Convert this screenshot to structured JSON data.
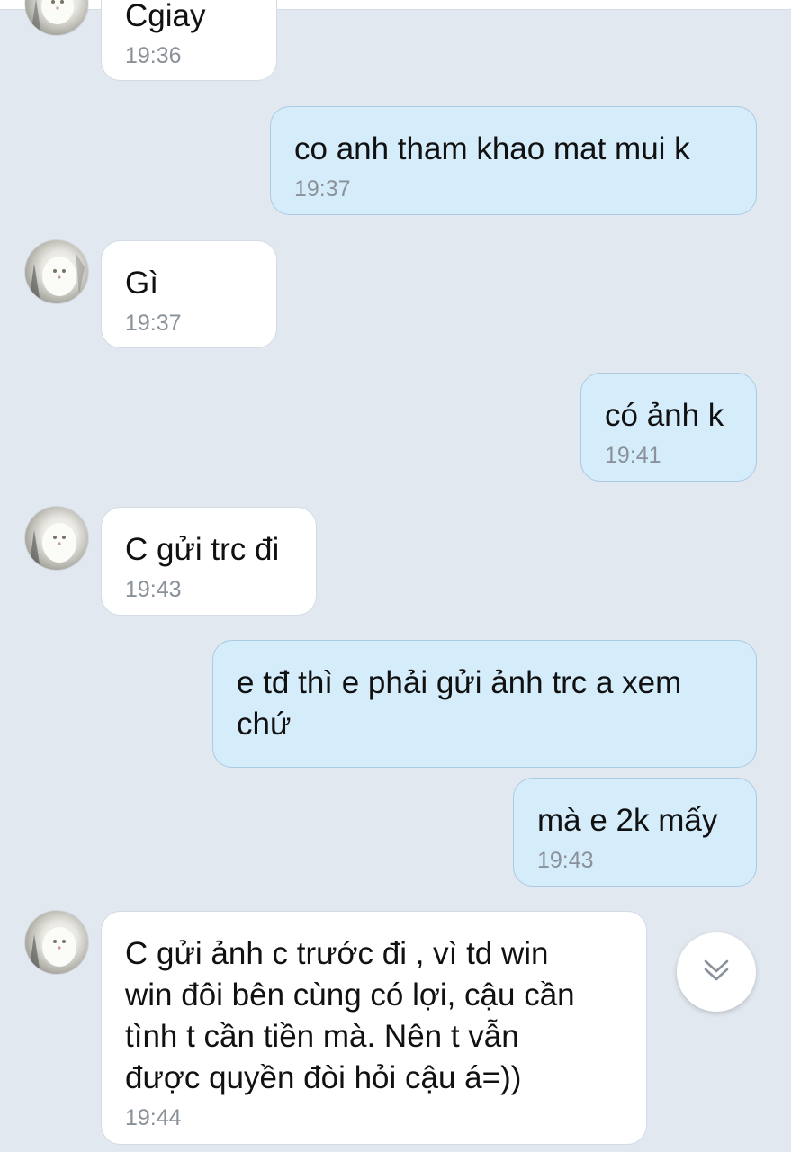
{
  "colors": {
    "background": "#e2e8f0",
    "incoming_bubble": "#ffffff",
    "outgoing_bubble": "#d5ecfb",
    "timestamp": "#8a9199"
  },
  "messages": [
    {
      "direction": "in",
      "text": "Cgiay",
      "time": "19:36",
      "avatar": "cat-avatar"
    },
    {
      "direction": "out",
      "text": "co anh tham khao mat mui k",
      "time": "19:37"
    },
    {
      "direction": "in",
      "text": "Gì",
      "time": "19:37",
      "avatar": "cat-avatar"
    },
    {
      "direction": "out",
      "text": "có ảnh k",
      "time": "19:41"
    },
    {
      "direction": "in",
      "text": "C gửi trc đi",
      "time": "19:43",
      "avatar": "cat-avatar"
    },
    {
      "direction": "out",
      "text": "e tđ thì e phải gửi ảnh trc a xem\nchứ"
    },
    {
      "direction": "out",
      "text": "mà e 2k mấy",
      "time": "19:43"
    },
    {
      "direction": "in",
      "text": "C gửi ảnh c trước đi , vì td win\nwin đôi bên cùng có lợi, cậu cần\ntình t cần tiền mà. Nên t vẫn\nđược quyền đòi hỏi cậu á=))",
      "time": "19:44",
      "avatar": "cat-avatar"
    }
  ],
  "scroll_button": {
    "icon": "double-chevron-down-icon"
  }
}
